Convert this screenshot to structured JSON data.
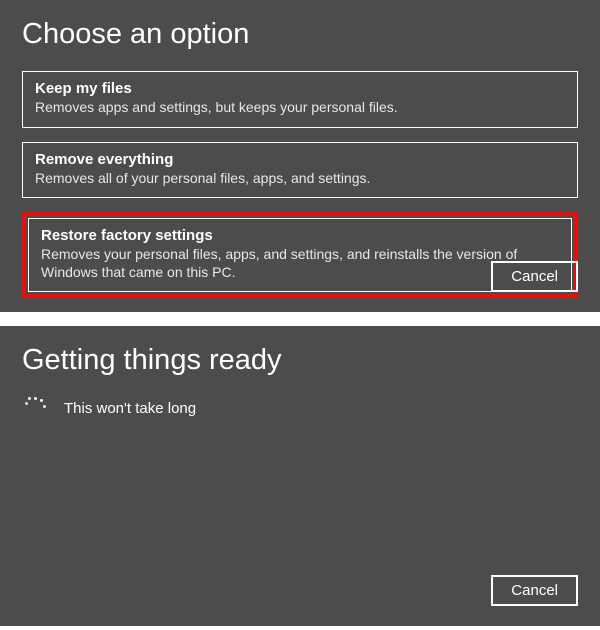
{
  "top": {
    "title": "Choose an option",
    "options": [
      {
        "title": "Keep my files",
        "desc": "Removes apps and settings, but keeps your personal files."
      },
      {
        "title": "Remove everything",
        "desc": "Removes all of your personal files, apps, and settings."
      },
      {
        "title": "Restore factory settings",
        "desc": "Removes your personal files, apps, and settings, and reinstalls the version of Windows that came on this PC."
      }
    ],
    "cancel": "Cancel"
  },
  "bottom": {
    "title": "Getting things ready",
    "message": "This won't take long",
    "cancel": "Cancel"
  }
}
